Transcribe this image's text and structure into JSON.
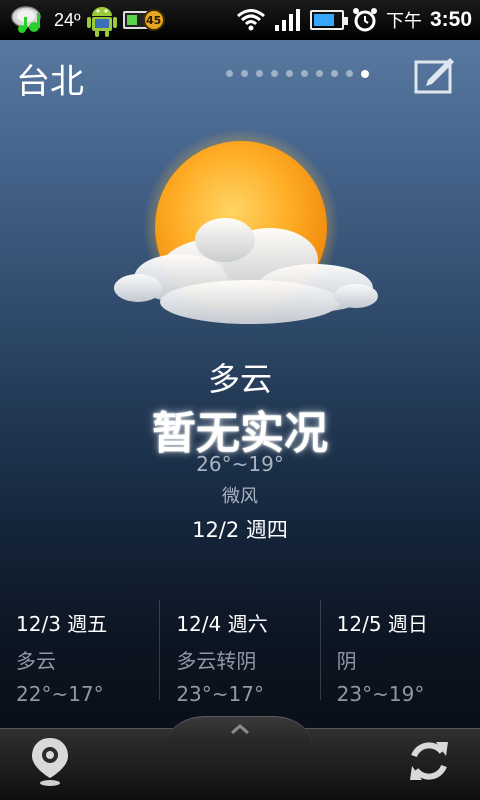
{
  "statusbar": {
    "temp": "24º",
    "battery_badge": "45",
    "ampm": "下午",
    "time": "3:50"
  },
  "header": {
    "city": "台北",
    "page_dots": 10,
    "active_dot": 9
  },
  "current": {
    "condition": "多云",
    "realtime": "暂无实况",
    "temp_range": "26°~19°",
    "wind": "微风",
    "date": "12/2 週四"
  },
  "forecast": [
    {
      "date": "12/3 週五",
      "condition": "多云",
      "temp": "22°~17°"
    },
    {
      "date": "12/4 週六",
      "condition": "多云转阴",
      "temp": "23°~17°"
    },
    {
      "date": "12/5 週日",
      "condition": "阴",
      "temp": "23°~19°"
    }
  ],
  "icons": {
    "weather": "sun-behind-cloud-icon",
    "edit": "edit-icon",
    "location": "location-pin-icon",
    "refresh": "refresh-icon",
    "handle": "chevron-up-icon"
  },
  "colors": {
    "sun": "#ffa21a",
    "battery_green": "#5ad24a",
    "battery_blue": "#35a7ff"
  }
}
